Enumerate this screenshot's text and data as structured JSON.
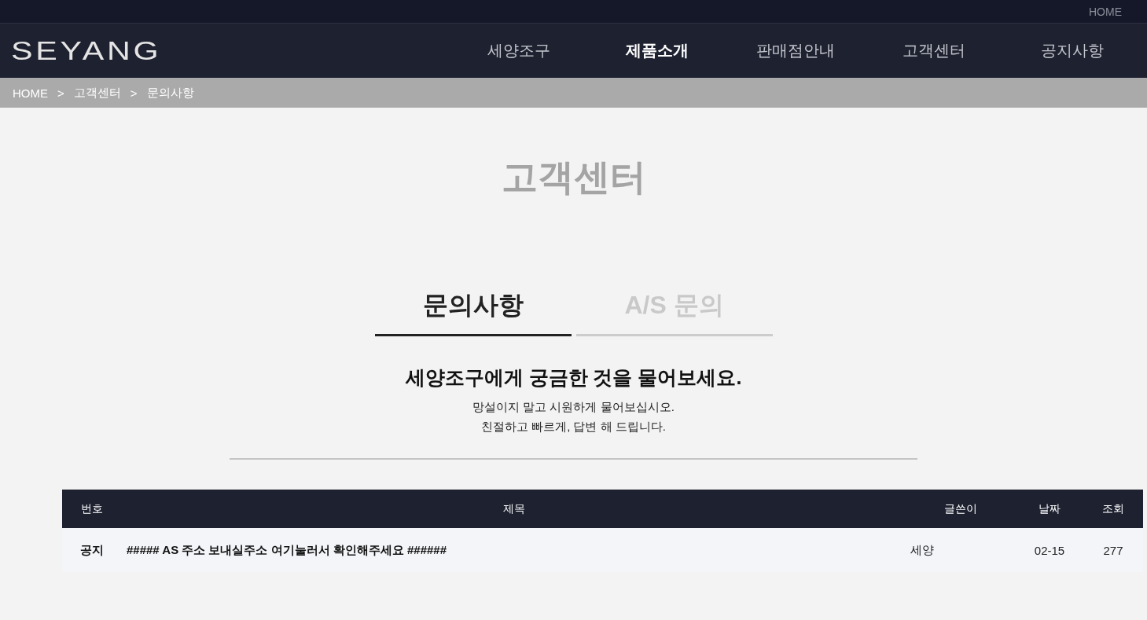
{
  "top_bar": {
    "link": "HOME"
  },
  "header": {
    "logo": "SEYANG",
    "nav": [
      {
        "label": "세양조구",
        "selected": false
      },
      {
        "label": "제품소개",
        "selected": true
      },
      {
        "label": "판매점안내",
        "selected": false
      },
      {
        "label": "고객센터",
        "selected": false
      },
      {
        "label": "공지사항",
        "selected": false
      }
    ]
  },
  "breadcrumb": [
    "HOME",
    ">",
    "고객센터",
    ">",
    "문의사항"
  ],
  "page_title": "고객센터",
  "tabs": [
    {
      "label": "문의사항",
      "selected": true
    },
    {
      "label": "A/S 문의",
      "selected": false
    }
  ],
  "intro": {
    "heading": "세양조구에게 궁금한 것을 물어보세요.",
    "lines": [
      "망설이지 말고 시원하게 물어보십시오.",
      "친절하고 빠르게, 답변 해 드립니다."
    ]
  },
  "table": {
    "columns": [
      "번호",
      "제목",
      "글쓴이",
      "날짜",
      "조회"
    ],
    "rows": [
      {
        "notice": true,
        "number": "공지",
        "title": "##### AS 주소 보내실주소 여기눌러서 확인해주세요 ######",
        "author": "세양",
        "date": "02-15",
        "views": "277"
      }
    ]
  }
}
